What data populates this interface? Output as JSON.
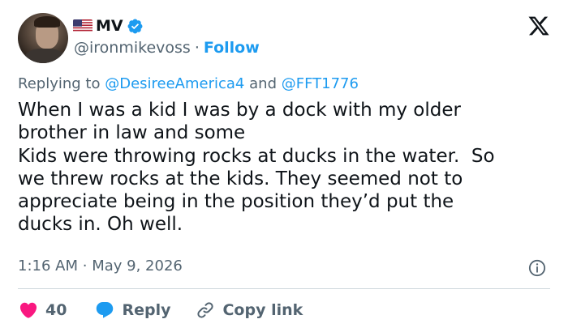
{
  "author": {
    "name": "MV",
    "handle": "@ironmikevoss",
    "follow_label": "Follow",
    "separator": "·"
  },
  "reply_context": {
    "prefix": "Replying to",
    "mention_1": "@DesireeAmerica4",
    "conjunction": "and",
    "mention_2": "@FFT1776"
  },
  "tweet": {
    "text": "When I was a kid I was by a dock with my older\nbrother in law and some\nKids were throwing rocks at ducks in the water.  So\nwe threw rocks at the kids. They seemed not to\nappreciate being in the position they’d put the\nducks in. Oh well."
  },
  "meta": {
    "time": "1:16 AM",
    "separator": "·",
    "date": "May 9, 2026"
  },
  "actions": {
    "like_count": "40",
    "reply_label": "Reply",
    "copy_link_label": "Copy link"
  },
  "icons": {
    "verified": "verified-badge-icon",
    "x_logo": "x-logo-icon",
    "info": "info-icon",
    "heart": "heart-icon",
    "reply": "reply-bubble-icon",
    "link": "link-icon",
    "flag": "us-flag-icon"
  },
  "colors": {
    "accent": "#1d9bf0",
    "like": "#f91880",
    "muted": "#536471",
    "text": "#0f1419"
  }
}
